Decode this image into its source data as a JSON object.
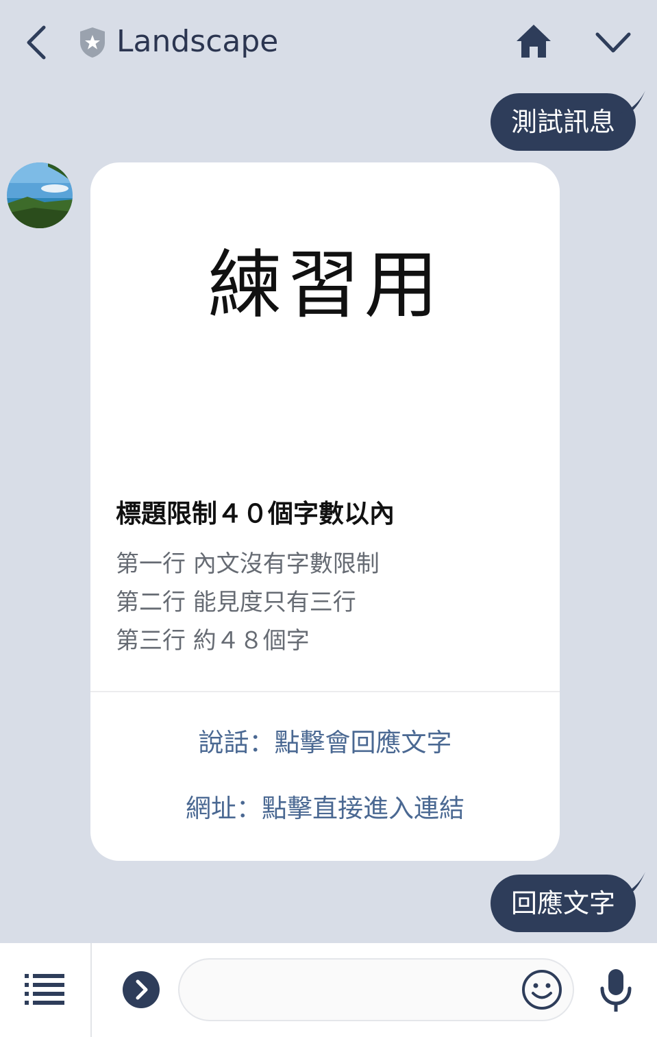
{
  "header": {
    "title": "Landscape"
  },
  "messages": {
    "outgoing_1": "測試訊息",
    "outgoing_2": "回應文字"
  },
  "card": {
    "hero_text": "練習用",
    "title": "標題限制４０個字數以內",
    "lines": [
      "第一行 內文沒有字數限制",
      "第二行 能見度只有三行",
      "第三行 約４８個字"
    ],
    "actions": [
      "說話：點擊會回應文字",
      "網址：點擊直接進入連結"
    ]
  },
  "composer": {
    "placeholder": ""
  },
  "colors": {
    "background": "#d8dde7",
    "bubble": "#2e3d5a",
    "action_text": "#4a6892",
    "icon": "#2e3d5a"
  },
  "icons": {
    "back": "chevron-left-icon",
    "official": "shield-star-icon",
    "home": "home-icon",
    "collapse": "chevron-down-icon",
    "menu": "list-menu-icon",
    "expand": "chevron-right-circle-icon",
    "emoji": "smiley-icon",
    "mic": "microphone-icon"
  }
}
